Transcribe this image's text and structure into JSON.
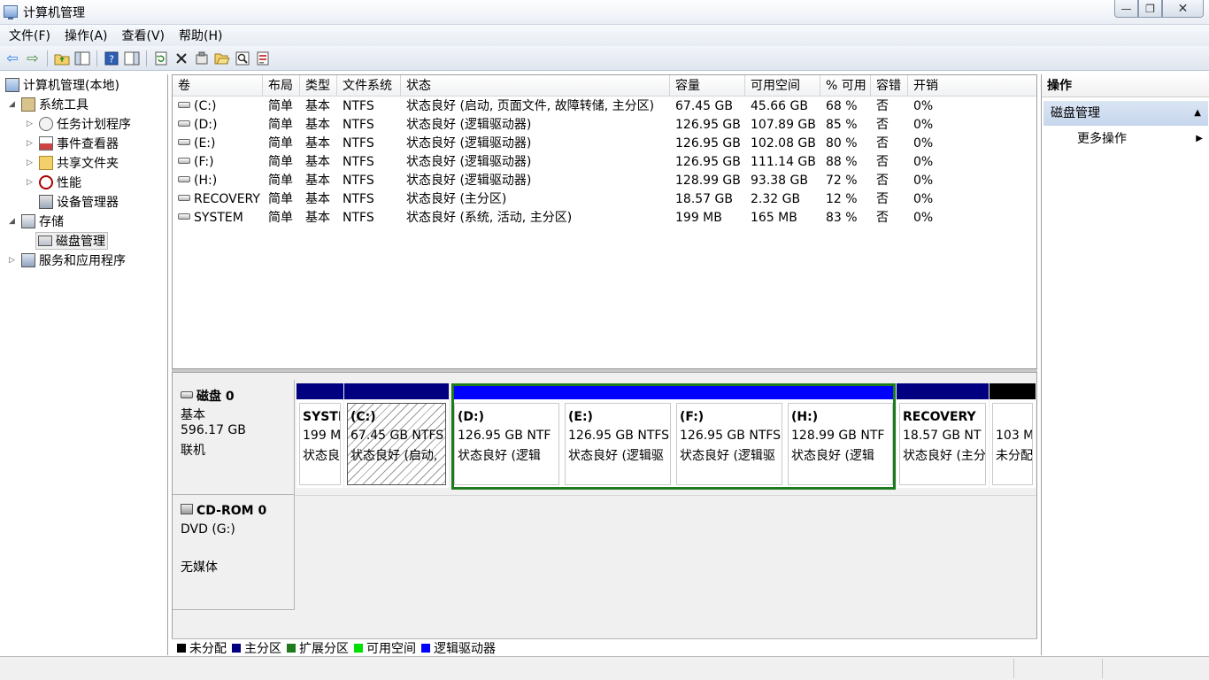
{
  "window": {
    "title": "计算机管理",
    "controls": {
      "minimize": "—",
      "maximize": "❐",
      "close": "✕"
    }
  },
  "menu": [
    "文件(F)",
    "操作(A)",
    "查看(V)",
    "帮助(H)"
  ],
  "toolbar": {
    "icons": [
      "back-icon",
      "forward-icon",
      "up-folder-icon",
      "show-hide-tree-icon",
      "help-icon",
      "action-pane-icon",
      "refresh-icon",
      "delete-icon",
      "properties-icon",
      "open-icon",
      "search-icon",
      "export-icon"
    ]
  },
  "tree": {
    "root": "计算机管理(本地)",
    "system_tools": "系统工具",
    "task_scheduler": "任务计划程序",
    "event_viewer": "事件查看器",
    "shared_folders": "共享文件夹",
    "performance": "性能",
    "device_manager": "设备管理器",
    "storage": "存储",
    "disk_management": "磁盘管理",
    "services": "服务和应用程序"
  },
  "volumes": {
    "columns": [
      "卷",
      "布局",
      "类型",
      "文件系统",
      "状态",
      "容量",
      "可用空间",
      "% 可用",
      "容错",
      "开销"
    ],
    "rows": [
      [
        "(C:)",
        "简单",
        "基本",
        "NTFS",
        "状态良好 (启动, 页面文件, 故障转储, 主分区)",
        "67.45 GB",
        "45.66 GB",
        "68 %",
        "否",
        "0%"
      ],
      [
        "(D:)",
        "简单",
        "基本",
        "NTFS",
        "状态良好 (逻辑驱动器)",
        "126.95 GB",
        "107.89 GB",
        "85 %",
        "否",
        "0%"
      ],
      [
        "(E:)",
        "简单",
        "基本",
        "NTFS",
        "状态良好 (逻辑驱动器)",
        "126.95 GB",
        "102.08 GB",
        "80 %",
        "否",
        "0%"
      ],
      [
        "(F:)",
        "简单",
        "基本",
        "NTFS",
        "状态良好 (逻辑驱动器)",
        "126.95 GB",
        "111.14 GB",
        "88 %",
        "否",
        "0%"
      ],
      [
        "(H:)",
        "简单",
        "基本",
        "NTFS",
        "状态良好 (逻辑驱动器)",
        "128.99 GB",
        "93.38 GB",
        "72 %",
        "否",
        "0%"
      ],
      [
        "RECOVERY",
        "简单",
        "基本",
        "NTFS",
        "状态良好 (主分区)",
        "18.57 GB",
        "2.32 GB",
        "12 %",
        "否",
        "0%"
      ],
      [
        "SYSTEM",
        "简单",
        "基本",
        "NTFS",
        "状态良好 (系统, 活动, 主分区)",
        "199 MB",
        "165 MB",
        "83 %",
        "否",
        "0%"
      ]
    ]
  },
  "disk0": {
    "name": "磁盘 0",
    "type": "基本",
    "size": "596.17 GB",
    "state": "联机",
    "partitions": [
      {
        "label": "SYSTI",
        "size": "199 M",
        "status": "状态良",
        "kind": "primary"
      },
      {
        "label": "(C:)",
        "size": "67.45 GB NTFS",
        "status": "状态良好 (启动,",
        "kind": "primary",
        "hatched": true
      },
      {
        "label": "(D:)",
        "size": "126.95 GB NTF",
        "status": "状态良好 (逻辑",
        "kind": "logical"
      },
      {
        "label": "(E:)",
        "size": "126.95 GB NTFS",
        "status": "状态良好 (逻辑驱",
        "kind": "logical"
      },
      {
        "label": "(F:)",
        "size": "126.95 GB NTFS",
        "status": "状态良好 (逻辑驱",
        "kind": "logical"
      },
      {
        "label": "(H:)",
        "size": "128.99 GB NTF",
        "status": "状态良好 (逻辑",
        "kind": "logical"
      },
      {
        "label": "RECOVERY",
        "size": "18.57 GB NT",
        "status": "状态良好 (主分",
        "kind": "primary"
      },
      {
        "label": "",
        "size": "103 M",
        "status": "未分配",
        "kind": "unallocated"
      }
    ]
  },
  "cdrom": {
    "name": "CD-ROM 0",
    "drive": "DVD (G:)",
    "media": "无媒体"
  },
  "legend": [
    {
      "label": "未分配",
      "color": "#000000"
    },
    {
      "label": "主分区",
      "color": "#000080"
    },
    {
      "label": "扩展分区",
      "color": "#1d7a1d"
    },
    {
      "label": "可用空间",
      "color": "#00e000"
    },
    {
      "label": "逻辑驱动器",
      "color": "#0000ff"
    }
  ],
  "actions": {
    "title": "操作",
    "group": "磁盘管理",
    "more": "更多操作"
  },
  "colors": {
    "primary": "#000080",
    "logical": "#0000ff",
    "unallocated": "#000000",
    "extended": "#1d7a1d"
  }
}
